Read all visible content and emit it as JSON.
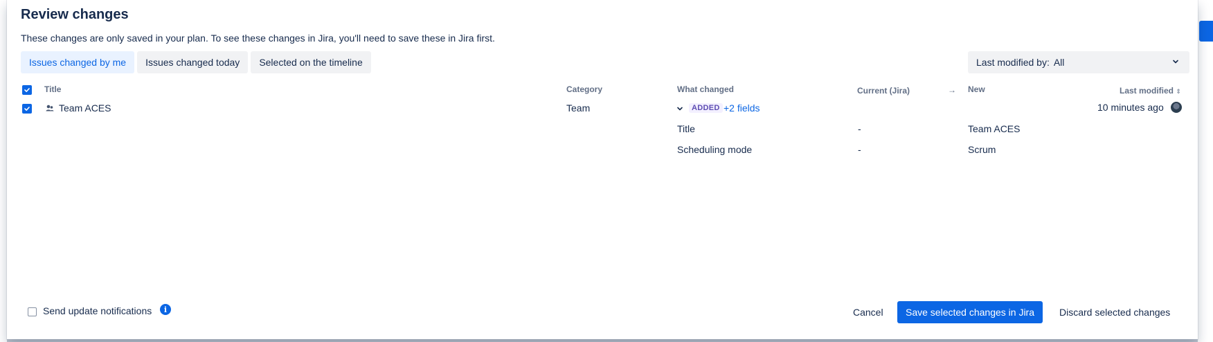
{
  "modal": {
    "title": "Review changes",
    "description": "These changes are only saved in your plan. To see these changes in Jira, you'll need to save these in Jira first."
  },
  "tabs": [
    {
      "label": "Issues changed by me",
      "active": true
    },
    {
      "label": "Issues changed today",
      "active": false
    },
    {
      "label": "Selected on the timeline",
      "active": false
    }
  ],
  "filter": {
    "label": "Last modified by:",
    "value": "All",
    "icon": "chevron-down-icon"
  },
  "table": {
    "headers": {
      "title": "Title",
      "category": "Category",
      "what_changed": "What changed",
      "current": "Current (Jira)",
      "arrow": "→",
      "new": "New",
      "last_modified": "Last modified"
    },
    "row": {
      "title": "Team ACES",
      "category": "Team",
      "badge": "ADDED",
      "fields_link": "+2 fields",
      "last_modified": "10 minutes ago",
      "checked": true,
      "changes": [
        {
          "field": "Title",
          "current": "-",
          "new": "Team ACES"
        },
        {
          "field": "Scheduling mode",
          "current": "-",
          "new": "Scrum"
        }
      ]
    }
  },
  "footer": {
    "notify_label": "Send update notifications",
    "cancel": "Cancel",
    "save": "Save selected changes in Jira",
    "discard": "Discard selected changes"
  },
  "colors": {
    "primary": "#0c66e4",
    "badge": "#5e4db2"
  }
}
